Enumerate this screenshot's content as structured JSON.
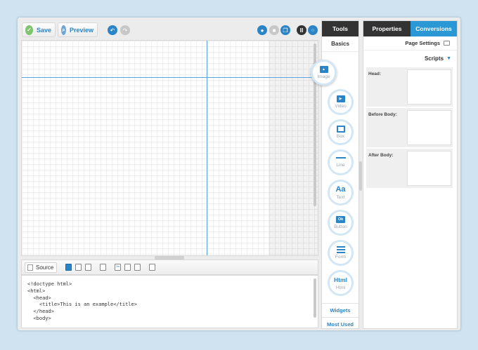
{
  "toolbar": {
    "save_label": "Save",
    "preview_label": "Preview"
  },
  "source": {
    "button_label": "Source",
    "code_lines": [
      "<!doctype html>",
      "<html>",
      "  <head>",
      "    <title>This is an example</title>",
      "  </head>",
      "  <body>"
    ]
  },
  "tools": {
    "tab_label": "Tools",
    "section_label": "Basics",
    "items": [
      {
        "label": "Image",
        "icon": "image-icon"
      },
      {
        "label": "Video",
        "icon": "video-icon"
      },
      {
        "label": "Box",
        "icon": "box-icon"
      },
      {
        "label": "Line",
        "icon": "line-icon"
      },
      {
        "label": "Text",
        "icon": "text-icon",
        "glyph": "Aa"
      },
      {
        "label": "Button",
        "icon": "button-icon",
        "glyph": "Ok"
      },
      {
        "label": "Form",
        "icon": "form-icon"
      },
      {
        "label": "Html",
        "icon": "html-icon",
        "glyph": "Html"
      }
    ],
    "widgets_label": "Widgets",
    "most_used_label": "Most Used"
  },
  "properties": {
    "tab_properties": "Properties",
    "tab_conversions": "Conversions",
    "page_settings_label": "Page Settings",
    "scripts_label": "Scripts",
    "rows": [
      {
        "label": "Head:"
      },
      {
        "label": "Before Body:"
      },
      {
        "label": "After Body:"
      }
    ]
  },
  "colors": {
    "accent": "#2a84c6",
    "dark_tab": "#333333",
    "active_tab": "#2a98d4",
    "background": "#cfe3f1"
  }
}
